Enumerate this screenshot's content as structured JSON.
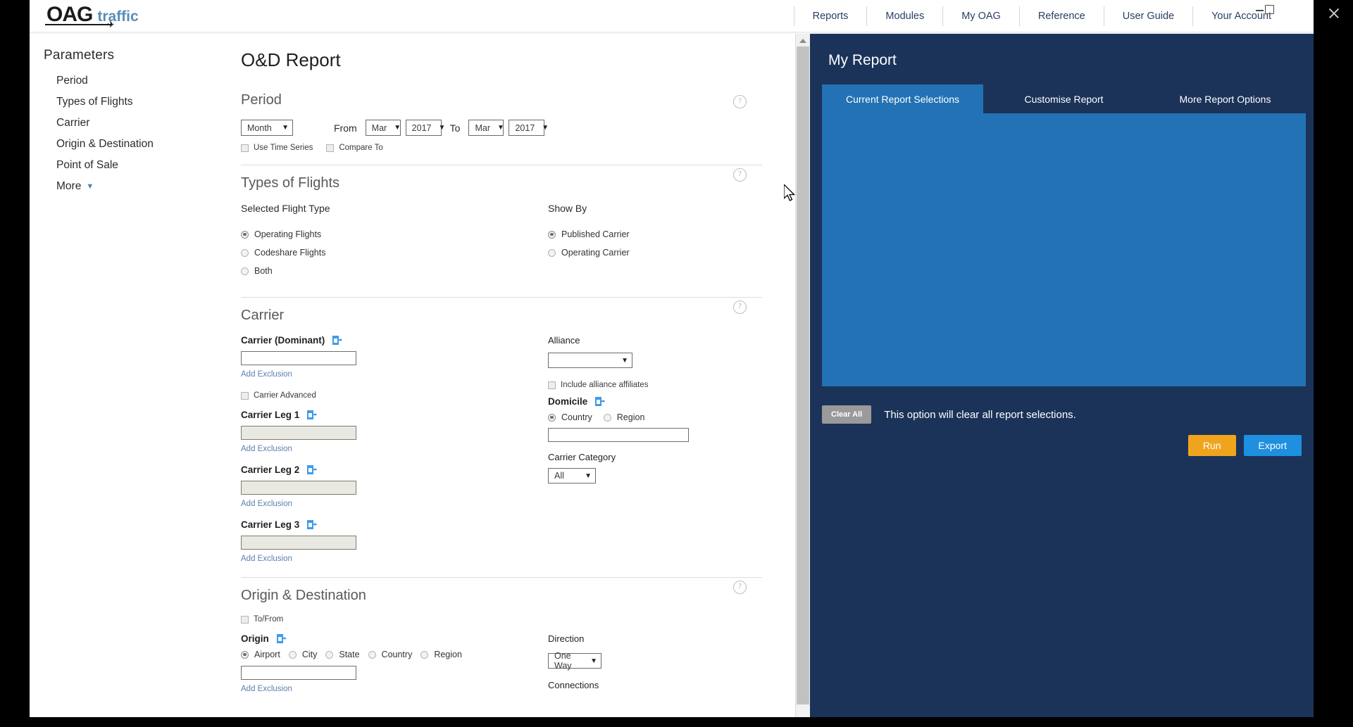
{
  "window": {
    "close_label": "×",
    "minimize_label": "–",
    "restore_label": "□"
  },
  "brand": {
    "primary": "OAG",
    "secondary": "traffic"
  },
  "topnav": {
    "items": [
      {
        "label": "Reports"
      },
      {
        "label": "Modules"
      },
      {
        "label": "My OAG"
      },
      {
        "label": "Reference"
      },
      {
        "label": "User Guide"
      },
      {
        "label": "Your Account"
      }
    ]
  },
  "sidebar": {
    "heading": "Parameters",
    "items": [
      {
        "label": "Period"
      },
      {
        "label": "Types of Flights"
      },
      {
        "label": "Carrier"
      },
      {
        "label": "Origin & Destination"
      },
      {
        "label": "Point of Sale"
      },
      {
        "label": "More"
      }
    ]
  },
  "main": {
    "page_title": "O&D Report",
    "help_glyph": "?",
    "period": {
      "title": "Period",
      "granularity": "Month",
      "from_label": "From",
      "from_month": "Mar",
      "from_year": "2017",
      "to_label": "To",
      "to_month": "Mar",
      "to_year": "2017",
      "use_time_series": "Use Time Series",
      "compare_to": "Compare To"
    },
    "types_of_flights": {
      "title": "Types of Flights",
      "selected_flight_type_label": "Selected Flight Type",
      "show_by_label": "Show By",
      "flight_types": [
        {
          "label": "Operating Flights",
          "selected": true
        },
        {
          "label": "Codeshare Flights",
          "selected": false
        },
        {
          "label": "Both",
          "selected": false
        }
      ],
      "show_by": [
        {
          "label": "Published Carrier",
          "selected": true
        },
        {
          "label": "Operating Carrier",
          "selected": false
        }
      ]
    },
    "carrier": {
      "title": "Carrier",
      "dominant_label": "Carrier (Dominant)",
      "dominant_value": "",
      "add_exclusion": "Add Exclusion",
      "carrier_advanced": "Carrier Advanced",
      "leg1_label": "Carrier Leg 1",
      "leg1_value": "",
      "leg2_label": "Carrier Leg 2",
      "leg2_value": "",
      "leg3_label": "Carrier Leg 3",
      "leg3_value": "",
      "alliance_label": "Alliance",
      "alliance_value": "",
      "include_affiliates": "Include alliance affiliates",
      "domicile_label": "Domicile",
      "domicile_country": "Country",
      "domicile_region": "Region",
      "domicile_value": "",
      "carrier_category_label": "Carrier Category",
      "carrier_category_value": "All"
    },
    "origin_destination": {
      "title": "Origin & Destination",
      "to_from": "To/From",
      "origin_label": "Origin",
      "origin_types": [
        {
          "label": "Airport",
          "selected": true
        },
        {
          "label": "City",
          "selected": false
        },
        {
          "label": "State",
          "selected": false
        },
        {
          "label": "Country",
          "selected": false
        },
        {
          "label": "Region",
          "selected": false
        }
      ],
      "origin_value": "",
      "add_exclusion": "Add Exclusion",
      "direction_label": "Direction",
      "direction_value": "One Way",
      "connections_label": "Connections"
    }
  },
  "report_panel": {
    "title": "My Report",
    "tabs": [
      {
        "label": "Current Report Selections",
        "active": true
      },
      {
        "label": "Customise Report",
        "active": false
      },
      {
        "label": "More Report Options",
        "active": false
      }
    ],
    "clear_all_label": "Clear All",
    "clear_all_note": "This option will clear all report selections.",
    "run_label": "Run",
    "export_label": "Export"
  },
  "colors": {
    "navy": "#1b3359",
    "blue": "#2372b5",
    "run_orange": "#f0a41e",
    "export_blue": "#1f8fe0",
    "link": "#5b7fae",
    "icon_blue": "#3e9bea"
  }
}
